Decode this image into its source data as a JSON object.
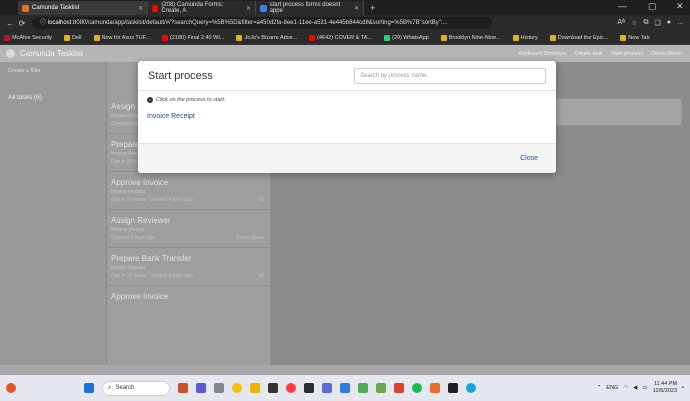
{
  "browser": {
    "tabs": [
      {
        "label": "Camunda Tasklist",
        "color": "#e66d2b",
        "active": true
      },
      {
        "label": "(208) Camunda Forms: Create, A",
        "color": "#ff0000",
        "active": false
      },
      {
        "label": "start process forms doesnt appe",
        "color": "#3b82f6",
        "active": false
      }
    ],
    "new_tab": "+",
    "url_host": "localhost",
    "url_rest": ":8080/camunda/app/tasklist/default/#/?searchQuery=%5B%5D&filter=a450d2fa-8ee1-11ee-a531-4e445b844cd8&sorting=%5B%7B\"sortBy\":...",
    "window_controls": [
      "—",
      "▢",
      "✕"
    ]
  },
  "bookmarks": [
    {
      "label": "McAfee Security",
      "color": "#c01818"
    },
    {
      "label": "Dell",
      "color": "#e0b020"
    },
    {
      "label": "New for Asus TUF...",
      "color": "#e0b020"
    },
    {
      "label": "(2180) Final 2:40 WI...",
      "color": "#ff0000"
    },
    {
      "label": "JoJo's Bizarre Adve...",
      "color": "#e0b020"
    },
    {
      "label": "(4642) COVER & TA...",
      "color": "#ff0000"
    },
    {
      "label": "(29) WhatsApp",
      "color": "#25d366"
    },
    {
      "label": "Brooklyn Nine-Nine...",
      "color": "#e0b020"
    },
    {
      "label": "History",
      "color": "#e0b020"
    },
    {
      "label": "Download the Epic...",
      "color": "#e0b020"
    },
    {
      "label": "New Tab",
      "color": "#e0b020"
    }
  ],
  "app": {
    "title": "Camunda Tasklist",
    "header_right": [
      "Keyboard Shortcuts",
      "Create task",
      "Start process",
      "Demo Demo"
    ],
    "filters_header": "Create a filter",
    "filter_item": "All tasks (6)",
    "tasks": [
      {
        "name": "Assign Reviewer",
        "sub": "Review Invoice",
        "meta": "Created a day ago",
        "prio": ""
      },
      {
        "name": "Prepare Bank Transfer",
        "sub": "Invoice Receipt",
        "meta": "Due in 22 hours, Created 4 days ago",
        "prio": "50"
      },
      {
        "name": "Approve Invoice",
        "sub": "Invoice Receipt",
        "meta": "Due in 22 hours, Created 4 days ago",
        "prio": "50"
      },
      {
        "name": "Assign Reviewer",
        "sub": "Review Invoice",
        "meta": "Created 4 days ago",
        "prio": "Demo Demo"
      },
      {
        "name": "Prepare Bank Transfer",
        "sub": "Invoice Receipt",
        "meta": "Due in 22 hours, Created 4 days ago",
        "prio": "50"
      },
      {
        "name": "Approve Invoice",
        "sub": "",
        "meta": "",
        "prio": ""
      }
    ]
  },
  "modal": {
    "title": "Start process",
    "search_placeholder": "Search by process name.",
    "hint": "Click on the process to start.",
    "process": "Invoice Receipt",
    "close": "Close"
  },
  "taskbar": {
    "search": "Search",
    "lang": "ENG",
    "time": "11:44 PM",
    "date": "12/5/2023"
  }
}
